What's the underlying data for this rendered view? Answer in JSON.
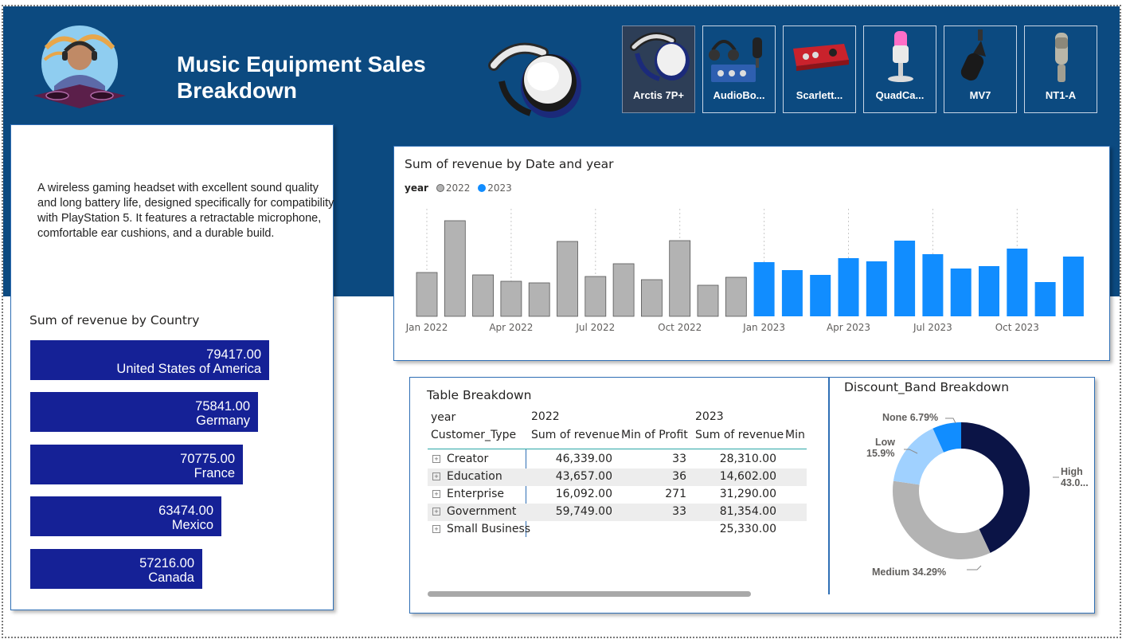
{
  "header": {
    "title_line1": "Music Equipment Sales",
    "title_line2": "Breakdown"
  },
  "products": [
    {
      "label": "Arctis 7P+",
      "icon": "headset-icon",
      "selected": true
    },
    {
      "label": "AudioBo...",
      "icon": "audio-interface-bundle-icon",
      "selected": false
    },
    {
      "label": "Scarlett...",
      "icon": "audio-interface-icon",
      "selected": false
    },
    {
      "label": "QuadCa...",
      "icon": "usb-microphone-icon",
      "selected": false
    },
    {
      "label": "MV7",
      "icon": "podcast-microphone-icon",
      "selected": false
    },
    {
      "label": "NT1-A",
      "icon": "condenser-microphone-icon",
      "selected": false
    }
  ],
  "description": "A wireless gaming headset with excellent sound quality and long battery life, designed specifically for compatibility with PlayStation 5. It features a retractable microphone, comfortable ear cushions, and a durable build.",
  "country_chart": {
    "title": "Sum of revenue by Country",
    "chart_data": {
      "type": "bar",
      "categories": [
        "United States of America",
        "Germany",
        "France",
        "Mexico",
        "Canada"
      ],
      "values": [
        "79417.00",
        "75841.00",
        "70775.00",
        "63474.00",
        "57216.00"
      ]
    }
  },
  "revenue_chart": {
    "title": "Sum of revenue by Date and year",
    "legend_title": "year",
    "legend": [
      {
        "name": "2022",
        "color": "#b3b3b3"
      },
      {
        "name": "2023",
        "color": "#118dff"
      }
    ],
    "x_ticks": [
      "Jan 2022",
      "Apr 2022",
      "Jul 2022",
      "Oct 2022",
      "Jan 2023",
      "Apr 2023",
      "Jul 2023",
      "Oct 2023"
    ],
    "chart_data": {
      "type": "bar",
      "x": [
        "Jan 2022",
        "Feb 2022",
        "Mar 2022",
        "Apr 2022",
        "May 2022",
        "Jun 2022",
        "Jul 2022",
        "Aug 2022",
        "Sep 2022",
        "Oct 2022",
        "Nov 2022",
        "Dec 2022",
        "Jan 2023",
        "Feb 2023",
        "Mar 2023",
        "Apr 2023",
        "May 2023",
        "Jun 2023",
        "Jul 2023",
        "Aug 2023",
        "Sep 2023",
        "Oct 2023",
        "Nov 2023",
        "Dec 2023"
      ],
      "series": [
        {
          "name": "2022",
          "color": "#b3b3b3",
          "values": [
            55,
            120,
            52,
            44,
            42,
            94,
            50,
            66,
            46,
            95,
            39,
            49,
            null,
            null,
            null,
            null,
            null,
            null,
            null,
            null,
            null,
            null,
            null,
            null
          ]
        },
        {
          "name": "2023",
          "color": "#118dff",
          "values": [
            null,
            null,
            null,
            null,
            null,
            null,
            null,
            null,
            null,
            null,
            null,
            null,
            68,
            58,
            52,
            73,
            69,
            95,
            78,
            60,
            63,
            85,
            43,
            75
          ]
        }
      ]
    }
  },
  "table": {
    "title": "Table Breakdown",
    "row_header_1": "year",
    "row_header_2": "Customer_Type",
    "years": [
      "2022",
      "2023"
    ],
    "columns": [
      "Sum of revenue",
      "Min of Profit",
      "Sum of revenue",
      "Min"
    ],
    "expand_symbol": "+",
    "rows": [
      {
        "type": "Creator",
        "rev2022": "46,339.00",
        "min2022": "33",
        "rev2023": "28,310.00"
      },
      {
        "type": "Education",
        "rev2022": "43,657.00",
        "min2022": "36",
        "rev2023": "14,602.00"
      },
      {
        "type": "Enterprise",
        "rev2022": "16,092.00",
        "min2022": "271",
        "rev2023": "31,290.00"
      },
      {
        "type": "Government",
        "rev2022": "59,749.00",
        "min2022": "33",
        "rev2023": "81,354.00"
      },
      {
        "type": "Small Business",
        "rev2022": "",
        "min2022": "",
        "rev2023": "25,330.00"
      }
    ]
  },
  "discount": {
    "title": "Discount_Band Breakdown",
    "labels": {
      "none": "None 6.79%",
      "low_1": "Low",
      "low_2": "15.9%",
      "high_1": "High",
      "high_2": "43.0...",
      "medium": "Medium 34.29%"
    },
    "chart_data": {
      "type": "pie",
      "categories": [
        "High",
        "Medium",
        "Low",
        "None"
      ],
      "values": [
        43.0,
        34.29,
        15.9,
        6.79
      ],
      "colors": [
        "#0b1446",
        "#b3b3b3",
        "#a0d1ff",
        "#118dff"
      ]
    }
  }
}
